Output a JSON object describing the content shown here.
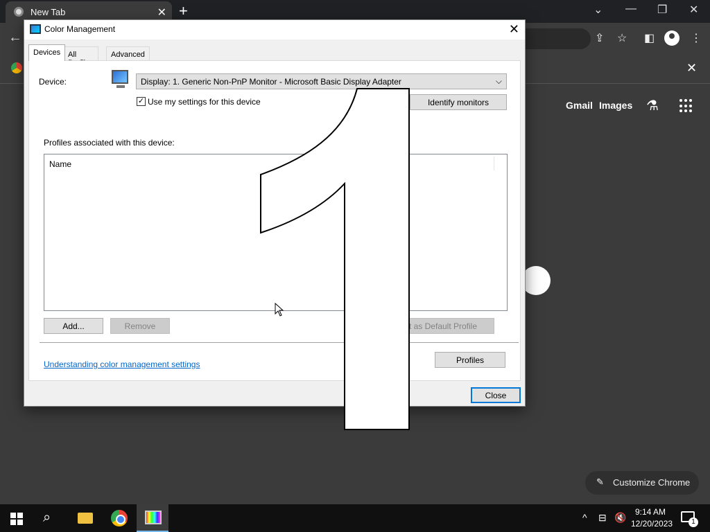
{
  "browser": {
    "tab_title": "New Tab",
    "tab_close": "✕",
    "new_tab": "+",
    "window_controls": {
      "dropdown": "⌄",
      "minimize": "—",
      "restore": "❐",
      "close": "✕"
    },
    "bookmark_close": "✕",
    "links": {
      "gmail": "Gmail",
      "images": "Images"
    },
    "customize_label": "Customize Chrome"
  },
  "dialog": {
    "title": "Color Management",
    "close": "✕",
    "tabs": [
      "Devices",
      "All Profiles",
      "Advanced"
    ],
    "active_tab": "Devices",
    "device_label": "Device:",
    "device_value": "Display: 1. Generic Non-PnP Monitor - Microsoft Basic Display Adapter",
    "use_my_settings_label": "Use my settings for this device",
    "use_my_settings_checked": true,
    "identify_button": "Identify monitors",
    "profiles_label": "Profiles associated with this device:",
    "list_column_name": "Name",
    "add_button": "Add...",
    "remove_button": "Remove",
    "set_default_button": "t as Default Profile",
    "profiles_button": "Profiles",
    "help_link": "Understanding color management settings",
    "close_button": "Close"
  },
  "identify_number": "1",
  "taskbar": {
    "time": "9:14 AM",
    "date": "12/20/2023",
    "notification_count": "1",
    "active_app": "color-management"
  }
}
